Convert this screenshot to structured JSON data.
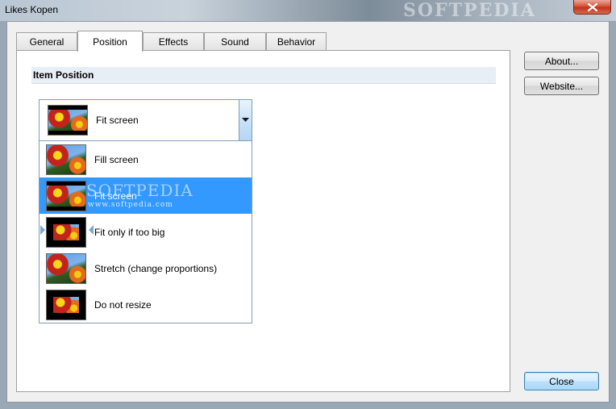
{
  "window": {
    "title": "Likes Kopen",
    "watermark": "SOFTPEDIA"
  },
  "tabs": [
    {
      "label": "General",
      "active": false
    },
    {
      "label": "Position",
      "active": true
    },
    {
      "label": "Effects",
      "active": false
    },
    {
      "label": "Sound",
      "active": false
    },
    {
      "label": "Behavior",
      "active": false
    }
  ],
  "section": {
    "title": "Item Position"
  },
  "combo": {
    "selected_label": "Fit screen"
  },
  "list": {
    "items": [
      {
        "label": "Fill screen",
        "thumb": "fill"
      },
      {
        "label": "Fit screen",
        "thumb": "fit",
        "selected": true
      },
      {
        "label": "Fit only if too big",
        "thumb": "small"
      },
      {
        "label": "Stretch (change proportions)",
        "thumb": "stretch"
      },
      {
        "label": "Do not resize",
        "thumb": "small"
      }
    ],
    "watermark": "SOFTPEDIA",
    "watermark_url": "www.softpedia.com"
  },
  "buttons": {
    "about": "About...",
    "website": "Website...",
    "close": "Close"
  },
  "colors": {
    "selection": "#3399ff",
    "section_header": "#e8eef6",
    "close_button_red": "#c3331a"
  }
}
